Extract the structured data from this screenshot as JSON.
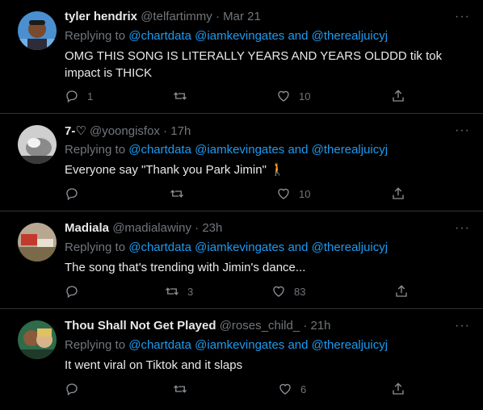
{
  "tweets": [
    {
      "name": "tyler hendrix",
      "handle": "@telfartimmy",
      "dot": "·",
      "time": "Mar 21",
      "replying": "Replying to",
      "mentions": [
        "@chartdata",
        "@iamkevingates",
        "and",
        "@therealjuicyj"
      ],
      "text": "OMG THIS SONG IS LITERALLY YEARS AND YEARS OLDDD tik tok impact is THICK",
      "replies": "1",
      "retweets": "",
      "likes": "10",
      "more": "···"
    },
    {
      "name": "7-♡",
      "handle": "@yoongisfox",
      "dot": "·",
      "time": "17h",
      "replying": "Replying to",
      "mentions": [
        "@chartdata",
        "@iamkevingates",
        "and",
        "@therealjuicyj"
      ],
      "text": "Everyone say \"Thank you Park Jimin\" 🚶",
      "replies": "",
      "retweets": "",
      "likes": "10",
      "more": "···"
    },
    {
      "name": "Madiala",
      "handle": "@madialawiny",
      "dot": "·",
      "time": "23h",
      "replying": "Replying to",
      "mentions": [
        "@chartdata",
        "@iamkevingates",
        "and",
        "@therealjuicyj"
      ],
      "text": "The song that's trending with Jimin's dance...",
      "replies": "",
      "retweets": "3",
      "likes": "83",
      "more": "···"
    },
    {
      "name": "Thou Shall Not Get Played",
      "handle": "@roses_child_",
      "dot": "·",
      "time": "21h",
      "replying": "Replying to",
      "mentions": [
        "@chartdata",
        "@iamkevingates",
        "and",
        "@therealjuicyj"
      ],
      "text": "It went viral on Tiktok and it slaps",
      "replies": "",
      "retweets": "",
      "likes": "6",
      "more": "···"
    }
  ],
  "colors": {
    "background": "#000000",
    "link": "#1d9bf0",
    "muted": "#71767b",
    "text": "#e7e9ea",
    "divider": "#2f3336"
  },
  "icons": {
    "reply": "reply-icon",
    "retweet": "retweet-icon",
    "like": "heart-icon",
    "share": "share-icon",
    "more": "more-icon"
  }
}
